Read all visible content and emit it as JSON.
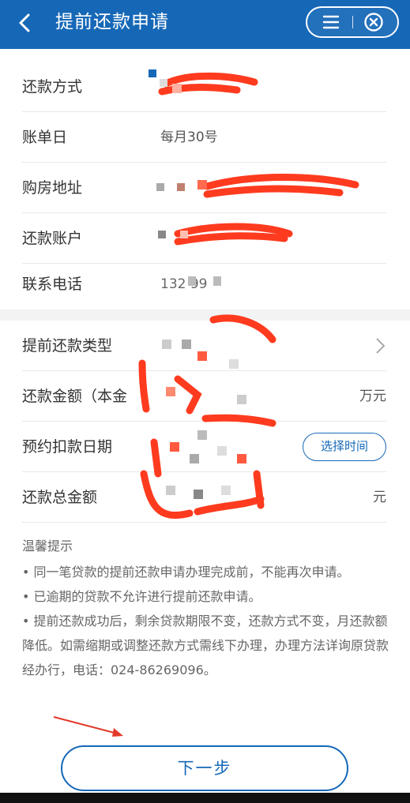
{
  "header": {
    "title": "提前还款申请",
    "back_icon": "chevron-left-icon",
    "menu_icon": "menu-icon",
    "close_icon": "close-circle-icon",
    "background": "#1668b7"
  },
  "info_rows": [
    {
      "label": "还款方式",
      "value": ""
    },
    {
      "label": "账单日",
      "value": "每月30号"
    },
    {
      "label": "购房地址",
      "value": ""
    },
    {
      "label": "还款账户",
      "value": ""
    },
    {
      "label": "联系电话",
      "value": "1⁠3⁠2      99"
    }
  ],
  "apply_rows": [
    {
      "label": "提前还款类型",
      "value": ""
    },
    {
      "label": "还款金额（本金",
      "value": "万元"
    },
    {
      "label": "预约扣款日期",
      "action": "选择时间"
    },
    {
      "label": "还款总金额",
      "value": "元"
    }
  ],
  "tips": {
    "title": "温馨提示",
    "items": [
      "• 同一笔贷款的提前还款申请办理完成前，不能再次申请。",
      "• 已逾期的贷款不允许进行提前还款申请。",
      "• 提前还款成功后，剩余贷款期限不变，还款方式不变，月还款额降低。如需缩期或调整还款方式需线下办理，办理方法详询原贷款经办行，电话：024-86269096。"
    ]
  },
  "next_button": "下一步",
  "accent_color": "#1668b7",
  "redaction_color": "#ff3b1f"
}
